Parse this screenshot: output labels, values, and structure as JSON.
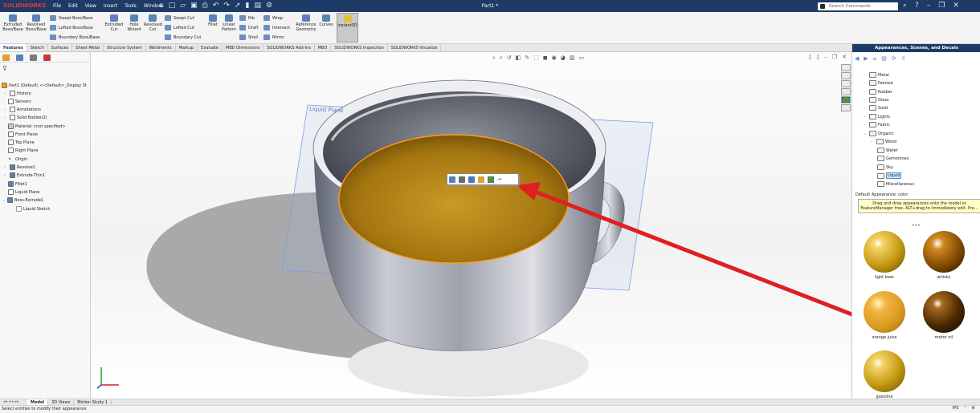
{
  "app": {
    "logo": "SOLIDWORKS",
    "document_title": "Part1 *",
    "menus": [
      "File",
      "Edit",
      "View",
      "Insert",
      "Tools",
      "Window"
    ],
    "search_placeholder": "Search Commands"
  },
  "ribbon": {
    "extruded_boss": "Extruded Boss/Base",
    "revolved_boss": "Revolved Boss/Base",
    "swept_boss": "Swept Boss/Base",
    "lofted_boss": "Lofted Boss/Base",
    "boundary_boss": "Boundary Boss/Base",
    "extruded_cut": "Extruded Cut",
    "hole_wizard": "Hole Wizard",
    "revolved_cut": "Revolved Cut",
    "swept_cut": "Swept Cut",
    "lofted_cut": "Lofted Cut",
    "boundary_cut": "Boundary Cut",
    "fillet": "Fillet",
    "linear_pattern": "Linear Pattern",
    "rib": "Rib",
    "draft": "Draft",
    "shell": "Shell",
    "wrap": "Wrap",
    "intersect": "Intersect",
    "mirror": "Mirror",
    "reference_geometry": "Reference Geometry",
    "curves": "Curves",
    "instant3d": "Instant3D"
  },
  "command_tabs": [
    "Features",
    "Sketch",
    "Surfaces",
    "Sheet Metal",
    "Structure System",
    "Weldments",
    "Markup",
    "Evaluate",
    "MBD Dimensions",
    "SOLIDWORKS Add-Ins",
    "MBD",
    "SOLIDWORKS Inspection",
    "SOLIDWORKS Visualize"
  ],
  "feature_tree": {
    "root": "Part1 (Default) <<Default>_Display St",
    "items": [
      "History",
      "Sensors",
      "Annotations",
      "Solid Bodies(2)",
      "Material <not specified>",
      "Front Plane",
      "Top Plane",
      "Right Plane",
      "Origin",
      "Revolve1",
      "Extrude-Thin1",
      "Fillet1",
      "Liquid Plane",
      "Boss-Extrude1",
      "Liquid Sketch"
    ]
  },
  "viewport": {
    "plane_label": "Liquid Plane"
  },
  "task_pane": {
    "title": "Appearances, Scenes, and Decals",
    "library": [
      "Metal",
      "Painted",
      "Rubber",
      "Glass",
      "Solid",
      "Lights",
      "Fabric",
      "Organic",
      "Wood",
      "Water",
      "Gemstones",
      "Sky",
      "Liquid",
      "Miscellaneous"
    ],
    "default_appearance": "Default Appearance: color",
    "tooltip": "Drag and drop appearances onto the model or FeatureManager tree. ALT+drag to immediately edit. Pre...",
    "swatches": [
      "light beer",
      "whisky",
      "orange juice",
      "motor oil",
      "gasoline"
    ]
  },
  "bottom_tabs": [
    "Model",
    "3D Views",
    "Motion Study 1"
  ],
  "status": {
    "message": "Select entities to modify their appearance",
    "units": "IPS"
  },
  "colors": {
    "title_bar": "#1e3a66",
    "liquid": "#b98a1a",
    "arrow": "#e02020",
    "selection": "#ff9a1a"
  }
}
